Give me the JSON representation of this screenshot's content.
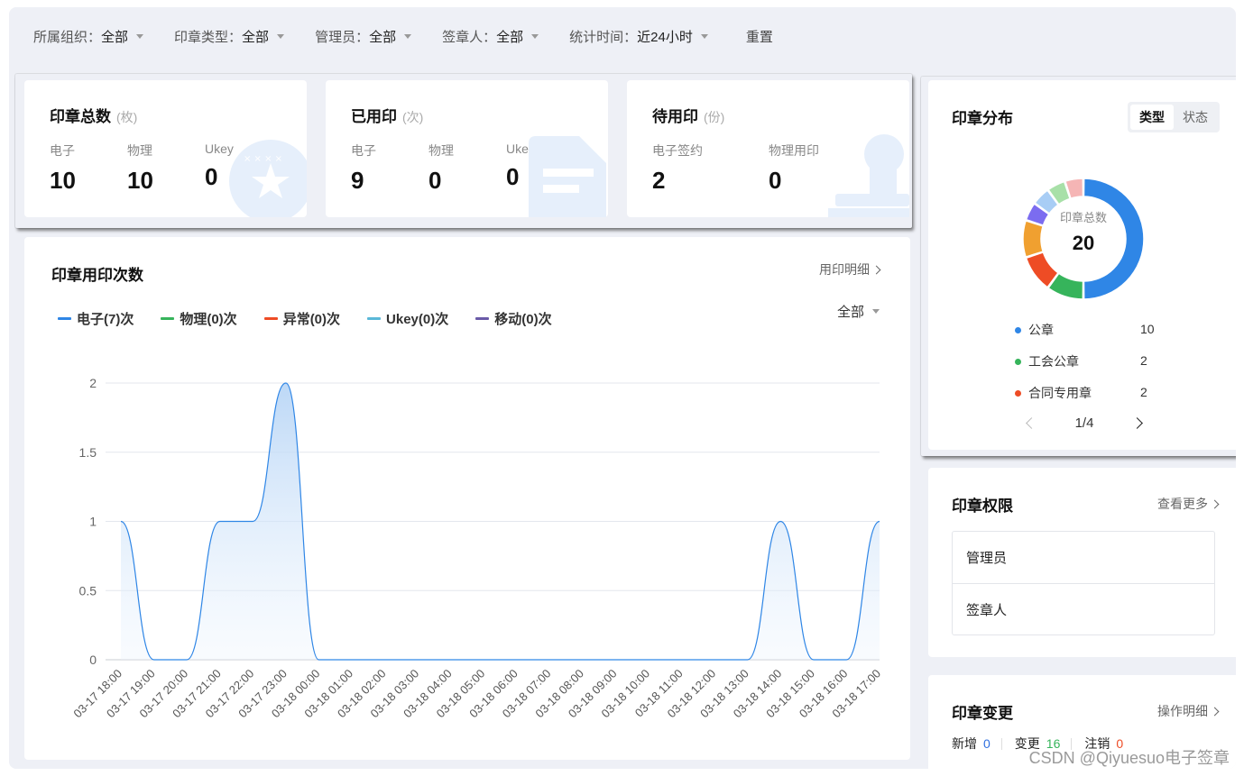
{
  "filters": [
    {
      "label": "所属组织：",
      "value": "全部"
    },
    {
      "label": "印章类型：",
      "value": "全部"
    },
    {
      "label": "管理员：",
      "value": "全部"
    },
    {
      "label": "签章人：",
      "value": "全部"
    },
    {
      "label": "统计时间：",
      "value": "近24小时"
    }
  ],
  "reset_label": "重置",
  "stats": [
    {
      "title": "印章总数",
      "unit": "(枚)",
      "items": [
        {
          "label": "电子",
          "value": "10"
        },
        {
          "label": "物理",
          "value": "10"
        },
        {
          "label": "Ukey",
          "value": "0"
        }
      ]
    },
    {
      "title": "已用印",
      "unit": "(次)",
      "items": [
        {
          "label": "电子",
          "value": "9"
        },
        {
          "label": "物理",
          "value": "0"
        },
        {
          "label": "Ukey",
          "value": "0"
        }
      ]
    },
    {
      "title": "待用印",
      "unit": "(份)",
      "items": [
        {
          "label": "电子签约",
          "value": "2"
        },
        {
          "label": "物理用印",
          "value": "0"
        }
      ]
    }
  ],
  "usage": {
    "title": "印章用印次数",
    "detail_link": "用印明细",
    "range_value": "全部"
  },
  "chart_data": {
    "type": "line",
    "title": "印章用印次数",
    "x": [
      "03-17 18:00",
      "03-17 19:00",
      "03-17 20:00",
      "03-17 21:00",
      "03-17 22:00",
      "03-17 23:00",
      "03-18 00:00",
      "03-18 01:00",
      "03-18 02:00",
      "03-18 03:00",
      "03-18 04:00",
      "03-18 05:00",
      "03-18 06:00",
      "03-18 07:00",
      "03-18 08:00",
      "03-18 09:00",
      "03-18 10:00",
      "03-18 11:00",
      "03-18 12:00",
      "03-18 13:00",
      "03-18 14:00",
      "03-18 15:00",
      "03-18 16:00",
      "03-18 17:00"
    ],
    "series": [
      {
        "name": "电子(7)次",
        "color": "#2f86e6",
        "values": [
          1,
          0,
          0,
          1,
          1,
          2,
          0,
          0,
          0,
          0,
          0,
          0,
          0,
          0,
          0,
          0,
          0,
          0,
          0,
          0,
          1,
          0,
          0,
          1
        ]
      },
      {
        "name": "物理(0)次",
        "color": "#36b45b",
        "values": [
          0,
          0,
          0,
          0,
          0,
          0,
          0,
          0,
          0,
          0,
          0,
          0,
          0,
          0,
          0,
          0,
          0,
          0,
          0,
          0,
          0,
          0,
          0,
          0
        ]
      },
      {
        "name": "异常(0)次",
        "color": "#ee4c25",
        "values": [
          0,
          0,
          0,
          0,
          0,
          0,
          0,
          0,
          0,
          0,
          0,
          0,
          0,
          0,
          0,
          0,
          0,
          0,
          0,
          0,
          0,
          0,
          0,
          0
        ]
      },
      {
        "name": "Ukey(0)次",
        "color": "#5ab8d8",
        "values": [
          0,
          0,
          0,
          0,
          0,
          0,
          0,
          0,
          0,
          0,
          0,
          0,
          0,
          0,
          0,
          0,
          0,
          0,
          0,
          0,
          0,
          0,
          0,
          0
        ]
      },
      {
        "name": "移动(0)次",
        "color": "#6a5aa8",
        "values": [
          0,
          0,
          0,
          0,
          0,
          0,
          0,
          0,
          0,
          0,
          0,
          0,
          0,
          0,
          0,
          0,
          0,
          0,
          0,
          0,
          0,
          0,
          0,
          0
        ]
      }
    ],
    "yticks": [
      "0",
      "0.5",
      "1",
      "1.5",
      "2"
    ],
    "ylim": [
      0,
      2
    ],
    "grid": true,
    "legend": "top-left"
  },
  "distribution": {
    "title": "印章分布",
    "tabs": [
      "类型",
      "状态"
    ],
    "active_tab": "类型",
    "center_label": "印章总数",
    "center_value": "20",
    "slices": [
      {
        "name": "公章",
        "value": 10,
        "color": "#2f86e6"
      },
      {
        "name": "工会公章",
        "value": 2,
        "color": "#36b45b"
      },
      {
        "name": "合同专用章",
        "value": 2,
        "color": "#ee4c25"
      },
      {
        "value": 2,
        "color": "#f0a030"
      },
      {
        "value": 1,
        "color": "#7b6cf0"
      },
      {
        "value": 1,
        "color": "#a8cdf5"
      },
      {
        "value": 1,
        "color": "#a8e0a8"
      },
      {
        "value": 1,
        "color": "#f5b5b5"
      }
    ],
    "list": [
      {
        "name": "公章",
        "value": "10",
        "color": "#2f86e6"
      },
      {
        "name": "工会公章",
        "value": "2",
        "color": "#36b45b"
      },
      {
        "name": "合同专用章",
        "value": "2",
        "color": "#ee4c25"
      }
    ],
    "pager": "1/4"
  },
  "permissions": {
    "title": "印章权限",
    "more_link": "查看更多",
    "rows": [
      "管理员",
      "签章人"
    ]
  },
  "changes": {
    "title": "印章变更",
    "detail_link": "操作明细",
    "items": [
      {
        "label": "新增",
        "value": "0",
        "color": "#2f6fe0"
      },
      {
        "label": "变更",
        "value": "16",
        "color": "#36b45b"
      },
      {
        "label": "注销",
        "value": "0",
        "color": "#ee4c25"
      }
    ]
  },
  "watermark": "CSDN @Qiyuesuo电子签章"
}
